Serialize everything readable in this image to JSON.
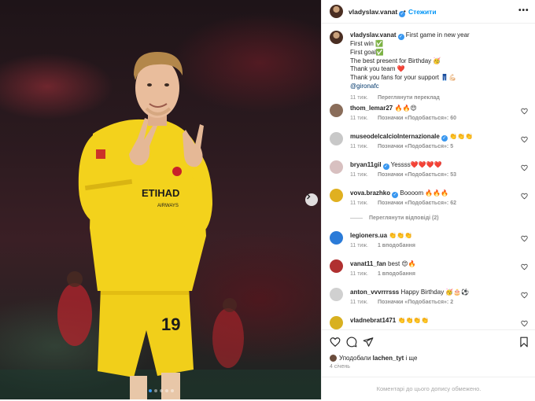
{
  "post": {
    "author": "vladyslav.vanat",
    "follow_label": "Стежити",
    "separator": "•",
    "more_icon": "more-horizontal-icon",
    "photo": {
      "jersey_sponsor": "ETIHAD",
      "jersey_sub": "AIRWAYS",
      "shirt_number": "19",
      "carousel_dots": 5,
      "active_dot": 1
    }
  },
  "caption": {
    "username": "vladyslav.vanat",
    "lines": [
      "First game in new year",
      "First win ✅",
      "First goal✅",
      "The best present for Birthday 🥳",
      "Thank you team ❤️",
      "Thank you fans for your support 👖💪🏻"
    ],
    "mention": "@gironafc",
    "time": "11 тиж.",
    "translate": "Переглянути переклад"
  },
  "comments": [
    {
      "username": "thom_lemar27",
      "verified": false,
      "text": "🔥🔥😍",
      "time": "11 тиж.",
      "meta": "Позначки «Подобається»: 60",
      "avatar_color": "#8a6d5a"
    },
    {
      "username": "museodelcalcioInternazionale",
      "verified": true,
      "text": "👏👏👏",
      "time": "11 тиж.",
      "meta": "Позначки «Подобається»: 5",
      "avatar_color": "#c8c8c8"
    },
    {
      "username": "bryan11gil",
      "verified": true,
      "text": "Yessss❤️❤️❤️❤️",
      "time": "11 тиж.",
      "meta": "Позначки «Подобається»: 53",
      "avatar_color": "#d8c0c0"
    },
    {
      "username": "vova.brazhko",
      "verified": true,
      "text": "Boooom 🔥🔥🔥",
      "time": "11 тиж.",
      "meta": "Позначки «Подобається»: 62",
      "avatar_color": "#e0b020"
    },
    {
      "username": "legioners.ua",
      "verified": false,
      "text": "👏👏👏",
      "time": "11 тиж.",
      "meta": "1 вподобання",
      "avatar_color": "#2b7bd8"
    },
    {
      "username": "vanat11_fan",
      "verified": false,
      "text": "best 😍🔥",
      "time": "11 тиж.",
      "meta": "1 вподобання",
      "avatar_color": "#b03030"
    },
    {
      "username": "anton_vvvrrrsss",
      "verified": false,
      "text": "Happy Birthday 🥳🎂⚽",
      "time": "11 тиж.",
      "meta": "Позначки «Подобається»: 2",
      "avatar_color": "#d0d0d0"
    },
    {
      "username": "vladnebrat1471",
      "verified": false,
      "text": "👏👏👏👏",
      "time": "11 тиж.",
      "meta": "",
      "avatar_color": "#d8b020"
    }
  ],
  "view_replies": "Переглянути відповіді (2)",
  "likes_summary": {
    "prefix": "Уподобали",
    "user": "lachen_tyt",
    "suffix": "і ще"
  },
  "date": "4 січень",
  "comments_closed": "Коментарі до цього допису обмежено.",
  "icons": {
    "like": "heart-icon",
    "comment": "comment-icon",
    "share": "share-icon",
    "save": "bookmark-icon",
    "next": "chevron-right-icon"
  },
  "colors": {
    "accent": "#0095f6",
    "verified": "#3897f0",
    "jersey": "#f3d21c"
  }
}
